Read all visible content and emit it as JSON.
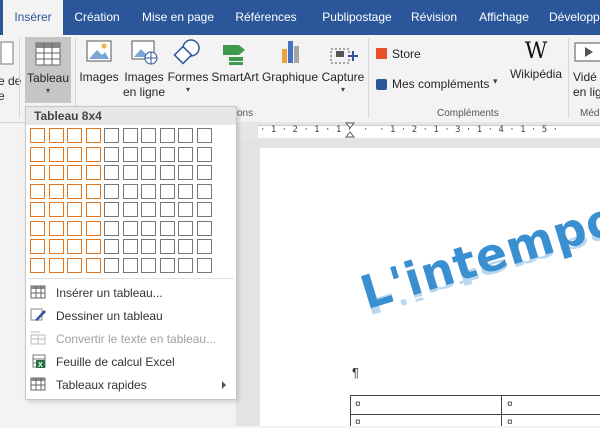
{
  "tabs": [
    {
      "label": "Insérer",
      "active": true
    },
    {
      "label": "Création"
    },
    {
      "label": "Mise en page"
    },
    {
      "label": "Références"
    },
    {
      "label": "Publipostage"
    },
    {
      "label": "Révision"
    },
    {
      "label": "Affichage"
    },
    {
      "label": "Développ"
    }
  ],
  "ribbon": {
    "left_clip": [
      "e de",
      "e"
    ],
    "tableau": "Tableau",
    "images": "Images",
    "images_en_ligne": [
      "Images",
      "en ligne"
    ],
    "formes": "Formes",
    "smartart": "SmartArt",
    "graphique": "Graphique",
    "capture": "Capture",
    "store": "Store",
    "mes_complements": "Mes compléments",
    "wikipedia": "Wikipédia",
    "video": [
      "Vidé",
      "en lig"
    ],
    "group_labels": {
      "illustrations_clip": "ons",
      "complements": "Compléments",
      "media_clip": "Méd"
    }
  },
  "ruler": {
    "numbers": "· 1 · 2 · 1 · 1 ·  ·  · 1 · 2 · 1 · 3 · 1 · 4 · 1 · 5 ·"
  },
  "dropdown": {
    "header": "Tableau 8x4",
    "grid": {
      "cols": 10,
      "rows": 8,
      "selected_cols": 4,
      "selected_rows": 8
    },
    "items": [
      {
        "label": "Insérer un tableau...",
        "icon": "insert-table-icon",
        "disabled": false
      },
      {
        "label": "Dessiner un tableau",
        "icon": "pencil-icon",
        "disabled": false
      },
      {
        "label": "Convertir le texte en tableau...",
        "icon": "convert-text-icon",
        "disabled": true
      },
      {
        "label": "Feuille de calcul Excel",
        "icon": "excel-icon",
        "disabled": false
      },
      {
        "label": "Tableaux rapides",
        "icon": "quick-tables-icon",
        "disabled": false,
        "submenu": true
      }
    ]
  },
  "document": {
    "wordart": "L'intemporel",
    "pilcrow": "¶",
    "cell_mark": "¤"
  },
  "colors": {
    "ribbon_blue": "#2b579a",
    "grid_highlight": "#e0761f",
    "wordart_blue": "#3a8fd1"
  }
}
